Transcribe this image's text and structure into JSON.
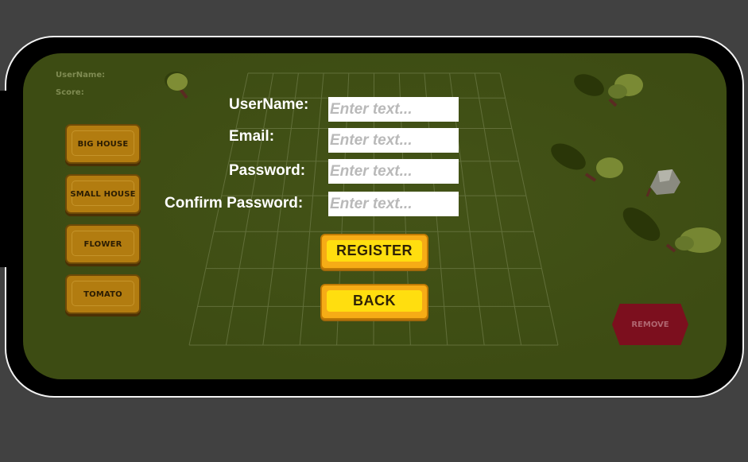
{
  "hud": {
    "username_label": "UserName:",
    "score_label": "Score:"
  },
  "build_menu": [
    {
      "label": "BIG HOUSE"
    },
    {
      "label": "SMALL HOUSE"
    },
    {
      "label": "FLOWER"
    },
    {
      "label": "TOMATO"
    }
  ],
  "remove_button": {
    "label": "REMOVE"
  },
  "form": {
    "username_label": "UserName:",
    "email_label": "Email:",
    "password_label": "Password:",
    "confirm_label": "Confirm Password:",
    "placeholder": "Enter text..."
  },
  "buttons": {
    "register": "REGISTER",
    "back": "BACK"
  },
  "colors": {
    "background": "#414141",
    "grass": "#3d4c13",
    "menu_button": "#b27c10",
    "remove_button": "#7c0f1e",
    "primary_button": "#ffde0f",
    "primary_button_border": "#f6ac16",
    "input_background": "#ffffff",
    "placeholder": "#b9b9b9"
  }
}
